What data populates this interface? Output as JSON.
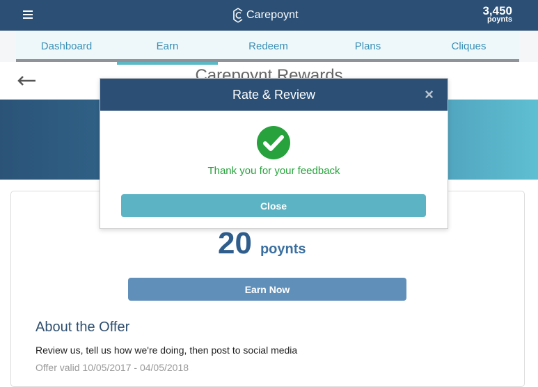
{
  "header": {
    "brand": "Carepoynt",
    "points_value": "3,450",
    "points_unit": "poynts"
  },
  "tabs": [
    {
      "label": "Dashboard"
    },
    {
      "label": "Earn"
    },
    {
      "label": "Redeem"
    },
    {
      "label": "Plans"
    },
    {
      "label": "Cliques"
    }
  ],
  "active_tab": "Earn",
  "page": {
    "title": "Carepoynt Rewards",
    "points_value": "20",
    "points_unit": "poynts",
    "earn_button": "Earn Now",
    "about_title": "About the Offer",
    "about_text": "Review us, tell us how we're doing, then post to social media",
    "about_extra": "Offer valid 10/05/2017 - 04/05/2018"
  },
  "modal": {
    "title": "Rate & Review",
    "close_icon": "×",
    "message": "Thank you for your feedback",
    "close_button": "Close"
  },
  "colors": {
    "navy": "#2b4f75",
    "teal": "#5bb3c3",
    "success_green": "#27a23c",
    "tab_text": "#3a8fb5"
  }
}
